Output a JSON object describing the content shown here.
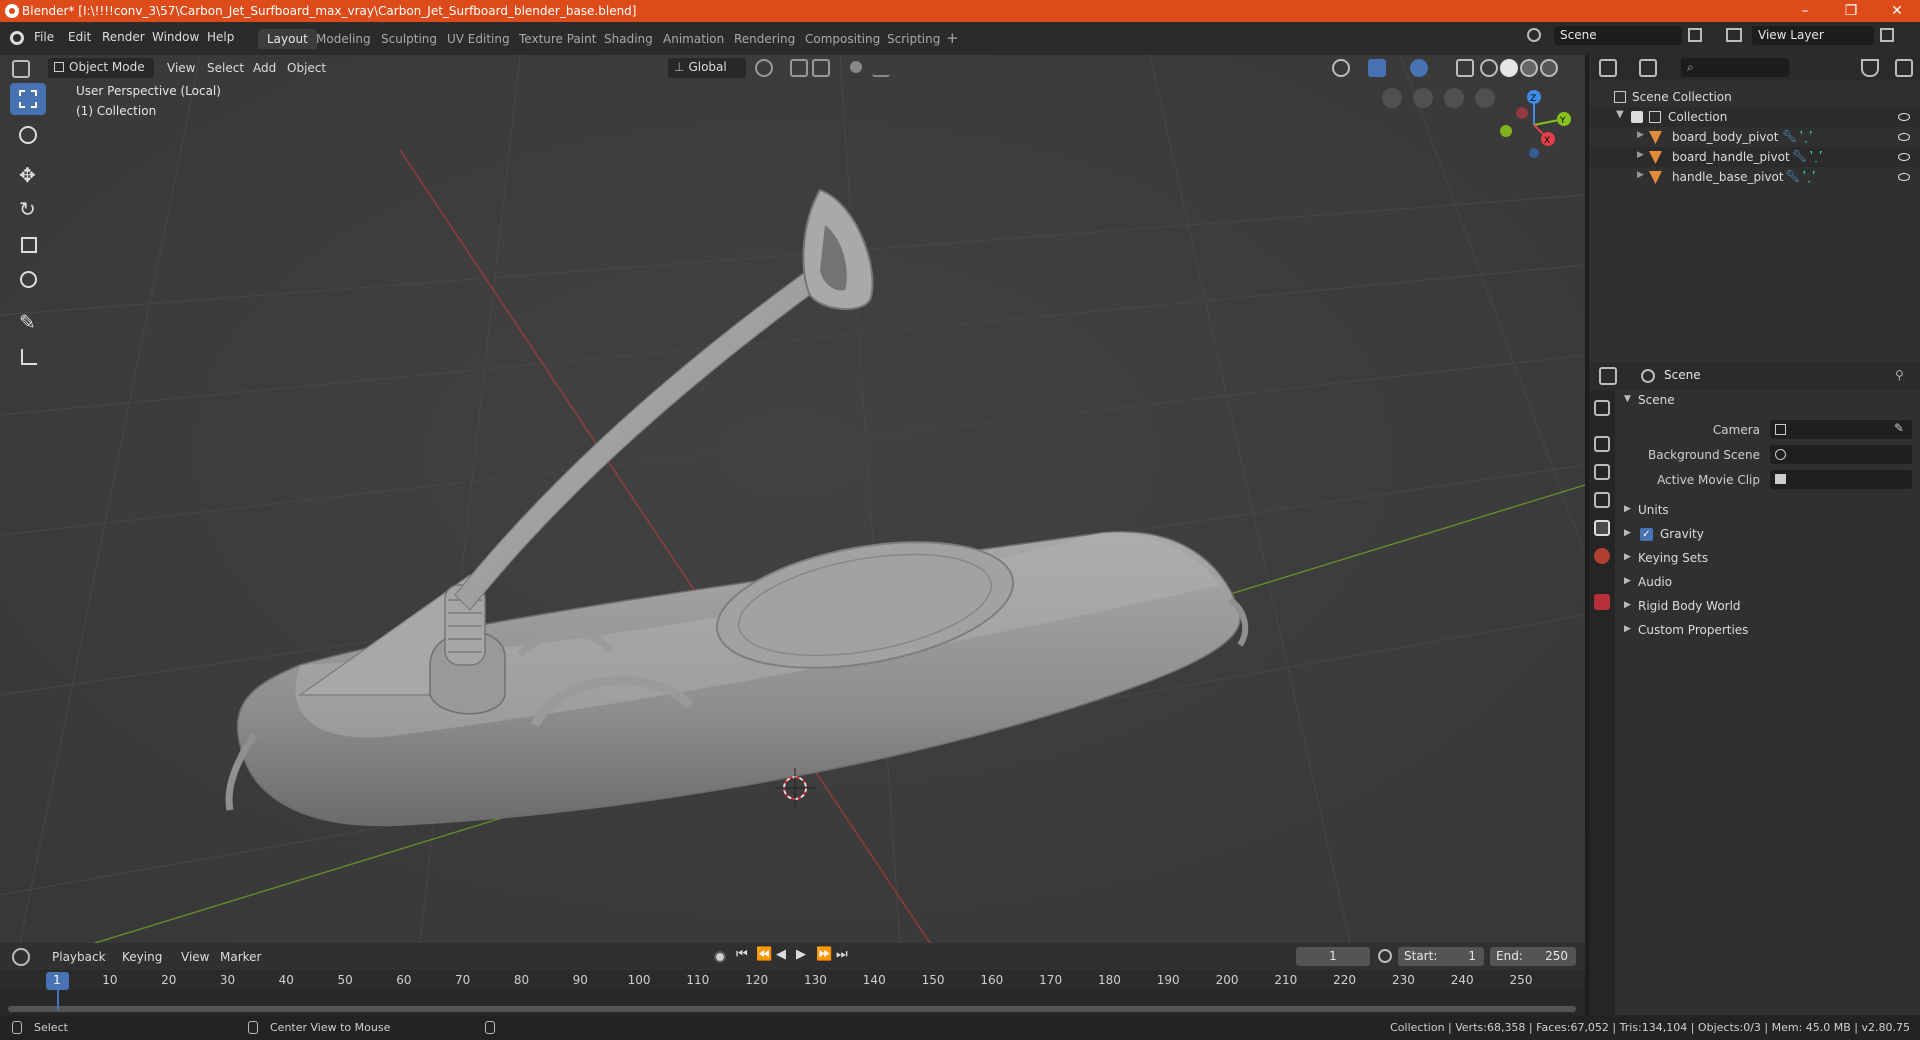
{
  "window": {
    "title": "Blender* [I:\\!!!!conv_3\\57\\Carbon_Jet_Surfboard_max_vray\\Carbon_Jet_Surfboard_blender_base.blend]",
    "minimize": "–",
    "restore": "❐",
    "close": "✕"
  },
  "menubar": {
    "items": [
      "File",
      "Edit",
      "Render",
      "Window",
      "Help"
    ],
    "workspaces": [
      "Layout",
      "Modeling",
      "Sculpting",
      "UV Editing",
      "Texture Paint",
      "Shading",
      "Animation",
      "Rendering",
      "Compositing",
      "Scripting"
    ],
    "active_workspace": "Layout",
    "add_workspace": "+",
    "scene_name": "Scene",
    "view_layer": "View Layer"
  },
  "viewport": {
    "mode": "Object Mode",
    "menus": [
      "View",
      "Select",
      "Add",
      "Object"
    ],
    "transform_orientation": "Global",
    "overlay_title": "User Perspective (Local)",
    "overlay_collection": "(1) Collection",
    "gizmo": {
      "x": "X",
      "y": "Y",
      "z": "Z"
    }
  },
  "outliner": {
    "root": "Scene Collection",
    "collection": "Collection",
    "objects": [
      "board_body_pivot",
      "board_handle_pivot",
      "handle_base_pivot"
    ]
  },
  "properties": {
    "context": "Scene",
    "panel": "Scene",
    "fields": [
      {
        "label": "Camera",
        "value": ""
      },
      {
        "label": "Background Scene",
        "value": ""
      },
      {
        "label": "Active Movie Clip",
        "value": ""
      }
    ],
    "subpanels": [
      "Units",
      "Gravity",
      "Keying Sets",
      "Audio",
      "Rigid Body World",
      "Custom Properties"
    ],
    "gravity_enabled": true
  },
  "timeline": {
    "menus": [
      "Playback",
      "Keying",
      "View",
      "Marker"
    ],
    "current_frame": "1",
    "start_label": "Start:",
    "start": "1",
    "end_label": "End:",
    "end": "250",
    "ruler": [
      "1",
      "10",
      "20",
      "30",
      "40",
      "50",
      "60",
      "70",
      "80",
      "90",
      "100",
      "110",
      "120",
      "130",
      "140",
      "150",
      "160",
      "170",
      "180",
      "190",
      "200",
      "210",
      "220",
      "230",
      "240",
      "250"
    ]
  },
  "statusbar": {
    "left_action": "Select",
    "mid_action": "Center View to Mouse",
    "stats": "Collection | Verts:68,358 | Faces:67,052 | Tris:134,104 | Objects:0/3 | Mem: 45.0 MB | v2.80.75"
  },
  "colors": {
    "title_bar": "#de4b1a",
    "active_tool": "#4772b3",
    "axis_x": "#e23d4b",
    "axis_y": "#87c11c",
    "axis_z": "#3f8be8"
  }
}
